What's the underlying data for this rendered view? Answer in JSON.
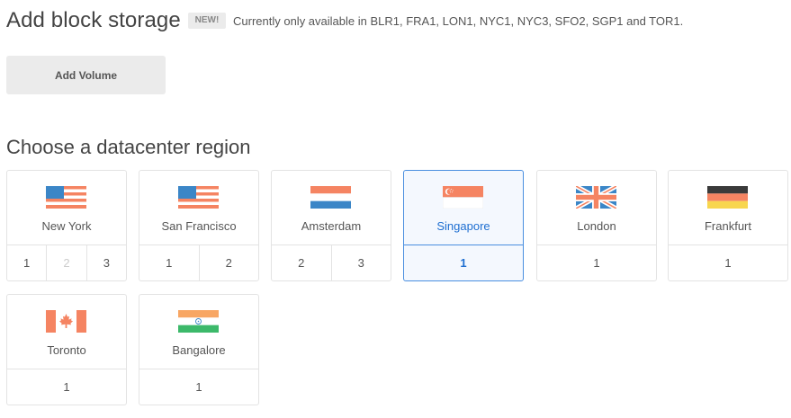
{
  "storage": {
    "title": "Add block storage",
    "badge": "NEW!",
    "availability": "Currently only available in BLR1, FRA1, LON1, NYC1, NYC3, SFO2, SGP1 and TOR1.",
    "add_volume_label": "Add Volume"
  },
  "region_section": {
    "title": "Choose a datacenter region"
  },
  "colors": {
    "selected_accent": "#1f6fd1",
    "flag_red": "#f58462",
    "flag_blue": "#3b86c7"
  },
  "regions": [
    {
      "city": "New York",
      "flag": "us-flag-icon",
      "selected": false,
      "datacenters": [
        {
          "label": "1",
          "enabled": true
        },
        {
          "label": "2",
          "enabled": false
        },
        {
          "label": "3",
          "enabled": true
        }
      ]
    },
    {
      "city": "San Francisco",
      "flag": "us-flag-icon",
      "selected": false,
      "datacenters": [
        {
          "label": "1",
          "enabled": true
        },
        {
          "label": "2",
          "enabled": true
        }
      ]
    },
    {
      "city": "Amsterdam",
      "flag": "nl-flag-icon",
      "selected": false,
      "datacenters": [
        {
          "label": "2",
          "enabled": true
        },
        {
          "label": "3",
          "enabled": true
        }
      ]
    },
    {
      "city": "Singapore",
      "flag": "sg-flag-icon",
      "selected": true,
      "datacenters": [
        {
          "label": "1",
          "enabled": true
        }
      ]
    },
    {
      "city": "London",
      "flag": "uk-flag-icon",
      "selected": false,
      "datacenters": [
        {
          "label": "1",
          "enabled": true
        }
      ]
    },
    {
      "city": "Frankfurt",
      "flag": "de-flag-icon",
      "selected": false,
      "datacenters": [
        {
          "label": "1",
          "enabled": true
        }
      ]
    },
    {
      "city": "Toronto",
      "flag": "ca-flag-icon",
      "selected": false,
      "datacenters": [
        {
          "label": "1",
          "enabled": true
        }
      ]
    },
    {
      "city": "Bangalore",
      "flag": "in-flag-icon",
      "selected": false,
      "datacenters": [
        {
          "label": "1",
          "enabled": true
        }
      ]
    }
  ]
}
